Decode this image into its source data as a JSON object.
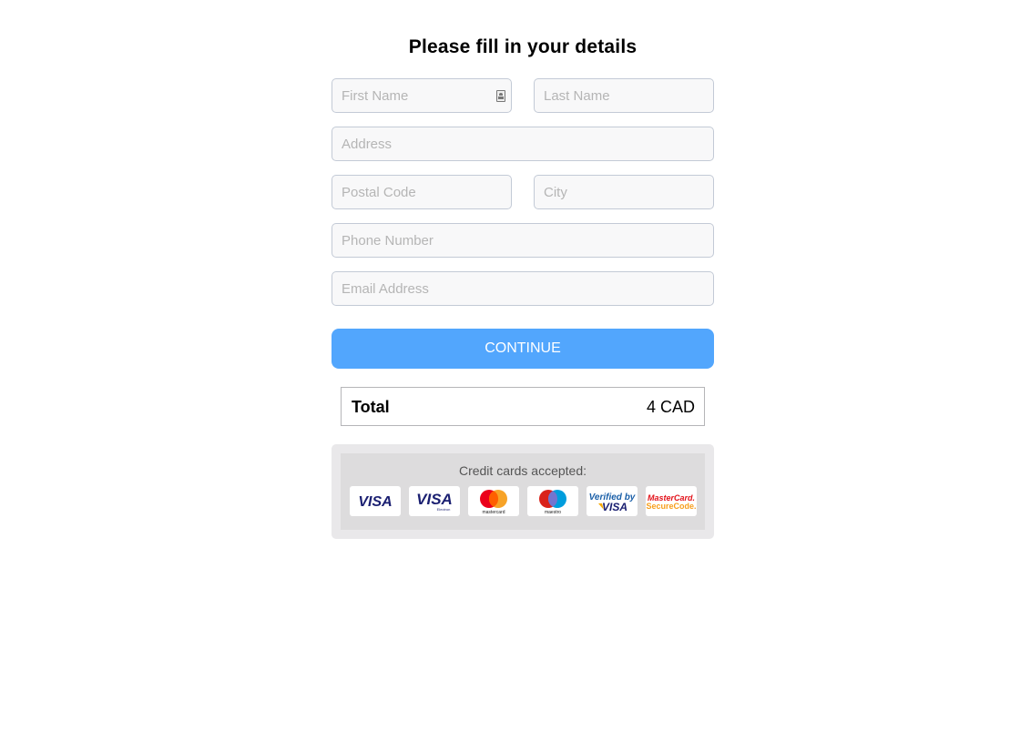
{
  "header": {
    "title": "Please fill in your details"
  },
  "form": {
    "first_name": {
      "placeholder": "First Name",
      "value": ""
    },
    "last_name": {
      "placeholder": "Last Name",
      "value": ""
    },
    "address": {
      "placeholder": "Address",
      "value": ""
    },
    "postal_code": {
      "placeholder": "Postal Code",
      "value": ""
    },
    "city": {
      "placeholder": "City",
      "value": ""
    },
    "phone": {
      "placeholder": "Phone Number",
      "value": ""
    },
    "email": {
      "placeholder": "Email Address",
      "value": ""
    },
    "continue_label": "CONTINUE"
  },
  "summary": {
    "total_label": "Total",
    "total_value": "4 CAD"
  },
  "payment": {
    "title": "Credit cards accepted:",
    "cards": [
      {
        "name": "visa",
        "text": "VISA"
      },
      {
        "name": "visa-electron",
        "text": "VISA",
        "subtext": "Electron"
      },
      {
        "name": "mastercard",
        "text": "mastercard"
      },
      {
        "name": "maestro",
        "text": "maestro"
      },
      {
        "name": "verified-by-visa",
        "text": "Verified by",
        "subtext": "VISA"
      },
      {
        "name": "mastercard-securecode",
        "text": "MasterCard.",
        "subtext": "SecureCode."
      }
    ]
  },
  "colors": {
    "accent": "#52a6fd",
    "visa_blue": "#1a1f71",
    "mc_red": "#eb001b",
    "mc_orange": "#f79e1b",
    "maestro_blue": "#009ddd"
  }
}
